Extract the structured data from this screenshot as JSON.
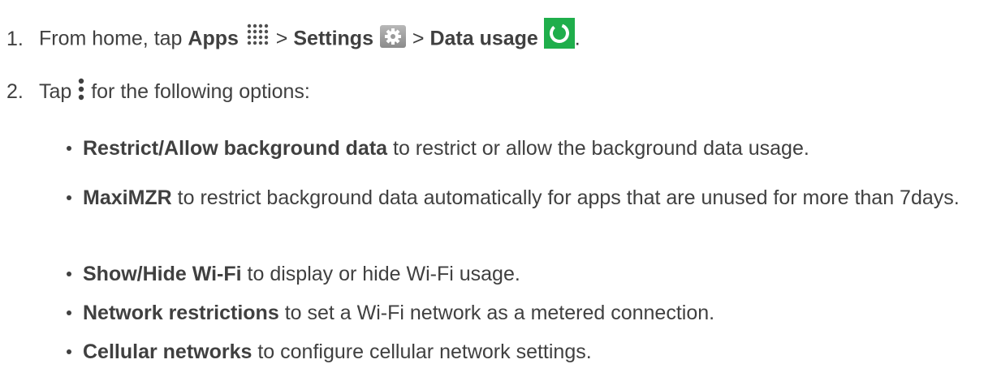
{
  "steps": [
    {
      "number": "1.",
      "parts": {
        "t1": "From home, tap ",
        "b1": "Apps",
        "t2": " > ",
        "b2": "Settings",
        "t3": " > ",
        "b3": "Data usage",
        "t4": "."
      },
      "icons": [
        "apps-grid-icon",
        "settings-gear-icon",
        "data-usage-icon"
      ]
    },
    {
      "number": "2.",
      "parts": {
        "t1": "Tap ",
        "t2": " for the following options:"
      },
      "icons": [
        "more-options-icon"
      ]
    }
  ],
  "options": [
    {
      "term": "Restrict/Allow background data",
      "desc": " to restrict or allow the background data usage."
    },
    {
      "term": "MaxiMZR",
      "desc": " to restrict background data automatically for apps that are unused for more than 7days."
    },
    {
      "term": "Show/Hide Wi-Fi",
      "desc": " to display or hide Wi-Fi usage."
    },
    {
      "term": "Network restrictions",
      "desc": " to set a Wi-Fi network as a metered connection."
    },
    {
      "term": "Cellular networks",
      "desc": " to configure cellular network settings."
    }
  ],
  "colors": {
    "text": "#404040",
    "data_usage_icon": "#1fae4b",
    "settings_icon": "#8a8a8a"
  }
}
